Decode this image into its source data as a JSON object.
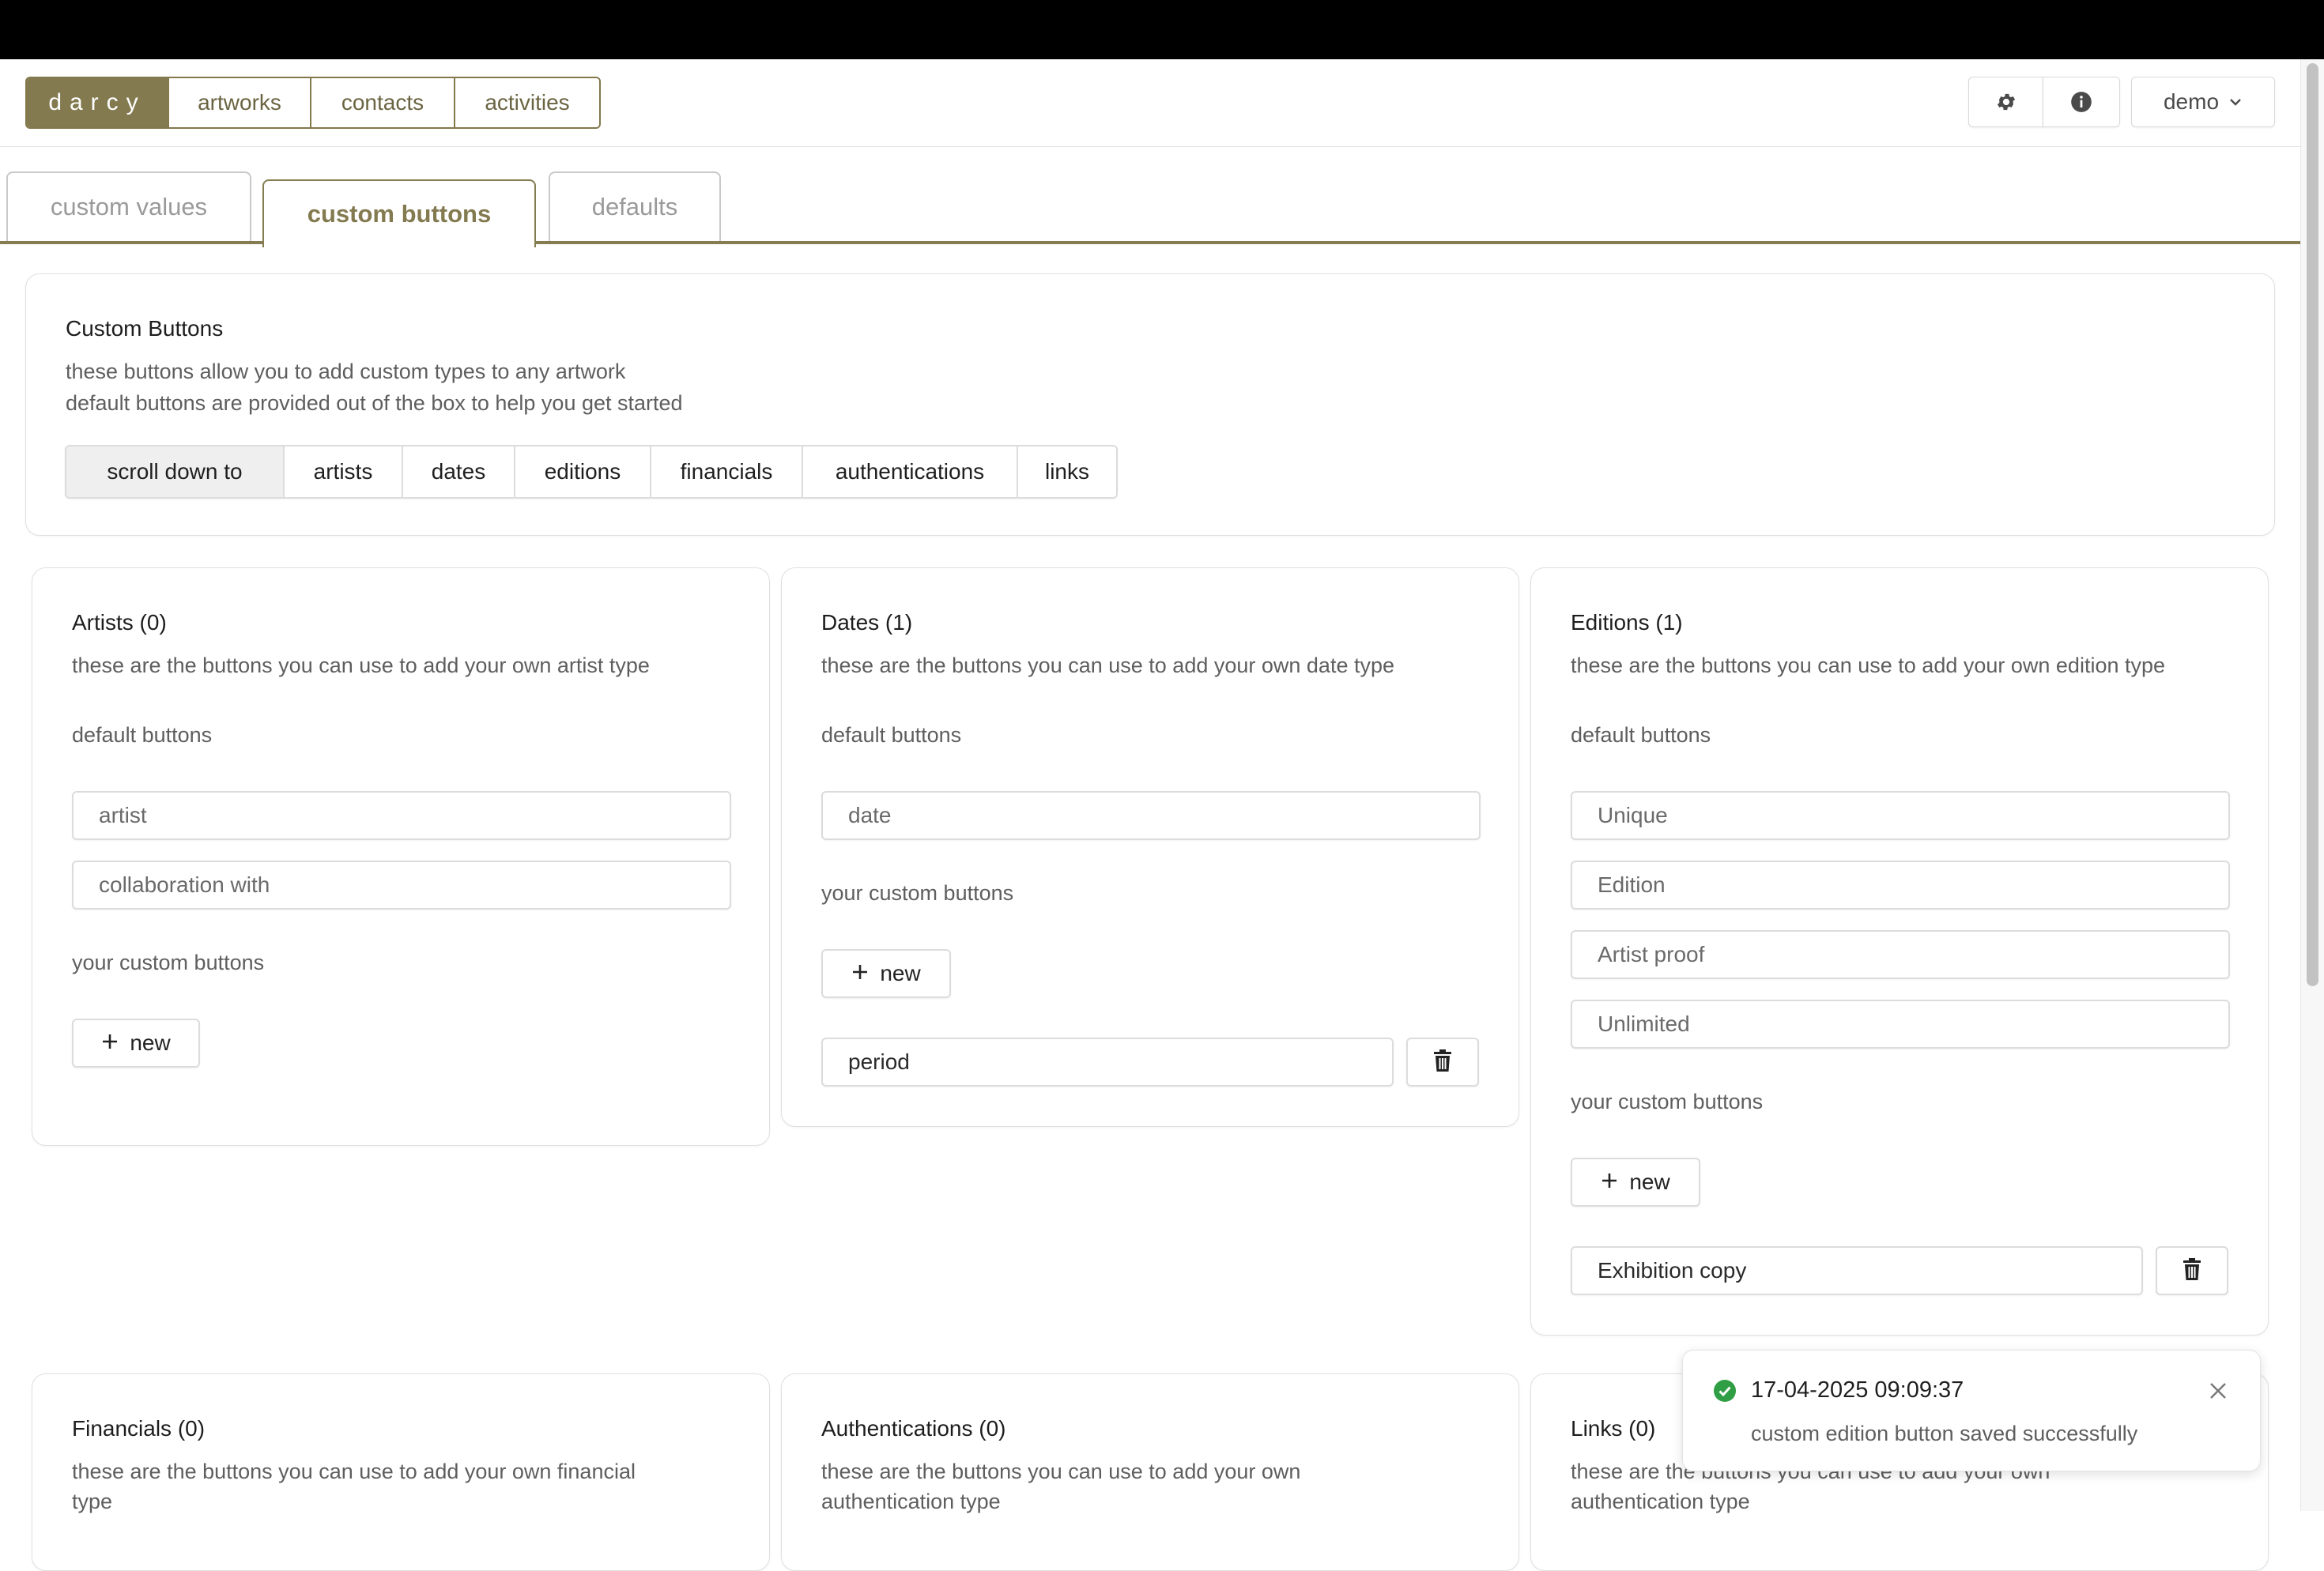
{
  "nav": {
    "brand": "darcy",
    "items": [
      {
        "label": "artworks"
      },
      {
        "label": "contacts"
      },
      {
        "label": "activities"
      }
    ],
    "user_label": "demo"
  },
  "tabs": [
    {
      "label": "custom values",
      "active": false
    },
    {
      "label": "custom buttons",
      "active": true
    },
    {
      "label": "defaults",
      "active": false
    }
  ],
  "intro": {
    "title": "Custom Buttons",
    "line1": "these buttons allow you to add custom types to any artwork",
    "line2": "default buttons are provided out of the box to help you get started",
    "scroll_label": "scroll down to",
    "scroll_links": [
      "artists",
      "dates",
      "editions",
      "financials",
      "authentications",
      "links"
    ]
  },
  "sections": {
    "artists": {
      "title": "Artists (0)",
      "desc": "these are the buttons you can use to add your own artist type",
      "default_label": "default buttons",
      "defaults": [
        "artist",
        "collaboration with"
      ],
      "custom_label": "your custom buttons",
      "new_label": "new",
      "custom": []
    },
    "dates": {
      "title": "Dates (1)",
      "desc": "these are the buttons you can use to add your own date type",
      "default_label": "default buttons",
      "defaults": [
        "date"
      ],
      "custom_label": "your custom buttons",
      "new_label": "new",
      "custom": [
        "period"
      ]
    },
    "editions": {
      "title": "Editions (1)",
      "desc": "these are the buttons you can use to add your own edition type",
      "default_label": "default buttons",
      "defaults": [
        "Unique",
        "Edition",
        "Artist proof",
        "Unlimited"
      ],
      "custom_label": "your custom buttons",
      "new_label": "new",
      "custom": [
        "Exhibition copy"
      ]
    },
    "financials": {
      "title": "Financials (0)",
      "desc_line1": "these are the buttons you can use to add your own financial",
      "desc_line2": "type"
    },
    "authentications": {
      "title": "Authentications (0)",
      "desc_line1": "these are the buttons you can use to add your own",
      "desc_line2": "authentication type"
    },
    "links": {
      "title": "Links (0)",
      "desc_line1": "these are the buttons you can use to add your own",
      "desc_line2": "authentication type"
    }
  },
  "toast": {
    "timestamp": "17-04-2025 09:09:37",
    "message": "custom edition button saved successfully"
  },
  "colors": {
    "accent": "#837a50",
    "success": "#2f9e44"
  }
}
